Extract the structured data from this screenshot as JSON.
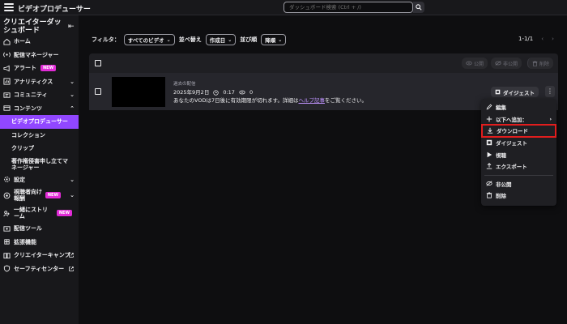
{
  "app": {
    "title": "ビデオプロデューサー"
  },
  "search": {
    "placeholder": "ダッシュボード検索 (Ctrl + /)"
  },
  "sidebar": {
    "title": "クリエイターダッシュボード",
    "items": [
      {
        "label": "ホーム"
      },
      {
        "label": "配信マネージャー"
      },
      {
        "label": "アラート",
        "badge": "NEW"
      },
      {
        "label": "アナリティクス"
      },
      {
        "label": "コミュニティ"
      },
      {
        "label": "コンテンツ"
      },
      {
        "label": "ビデオプロデューサー"
      },
      {
        "label": "コレクション"
      },
      {
        "label": "クリップ"
      },
      {
        "label": "著作権侵害申し立てマネージャー"
      },
      {
        "label": "設定"
      },
      {
        "label": "視聴者向け報酬",
        "badge": "NEW"
      },
      {
        "label": "一緒にストリーム",
        "badge": "NEW"
      },
      {
        "label": "配信ツール"
      },
      {
        "label": "拡張機能"
      },
      {
        "label": "クリエイターキャンプ"
      },
      {
        "label": "セーフティセンター"
      }
    ]
  },
  "toolbar": {
    "filter_label": "フィルタ：",
    "filter_value": "すべてのビデオ",
    "sort_label": "並べ替え",
    "sort_value": "作成日",
    "order_label": "並び順",
    "order_value": "降順",
    "pagination": "1-1/1"
  },
  "table": {
    "head_actions": {
      "publish": "公開",
      "unpublish": "非公開",
      "delete": "削除"
    },
    "rows": [
      {
        "type": "過去の配信",
        "date": "2025年9月2日",
        "duration": "0:17",
        "views": "0",
        "expiry_text": "あなたのVODは7日後に有効期限が切れます。詳細は",
        "help_link": "ヘルプ記事",
        "expiry_suffix": "をご覧ください。",
        "digest_button": "ダイジェスト"
      }
    ]
  },
  "menu": {
    "items": [
      {
        "label": "編集"
      },
      {
        "label": "以下へ追加："
      },
      {
        "label": "ダウンロード"
      },
      {
        "label": "ダイジェスト"
      },
      {
        "label": "視聴"
      },
      {
        "label": "エクスポート"
      },
      {
        "label": "非公開"
      },
      {
        "label": "削除"
      }
    ]
  },
  "colors": {
    "accent": "#9147ff",
    "badge": "#e12bd6",
    "highlight": "#e11d1d",
    "link": "#bf94ff"
  }
}
